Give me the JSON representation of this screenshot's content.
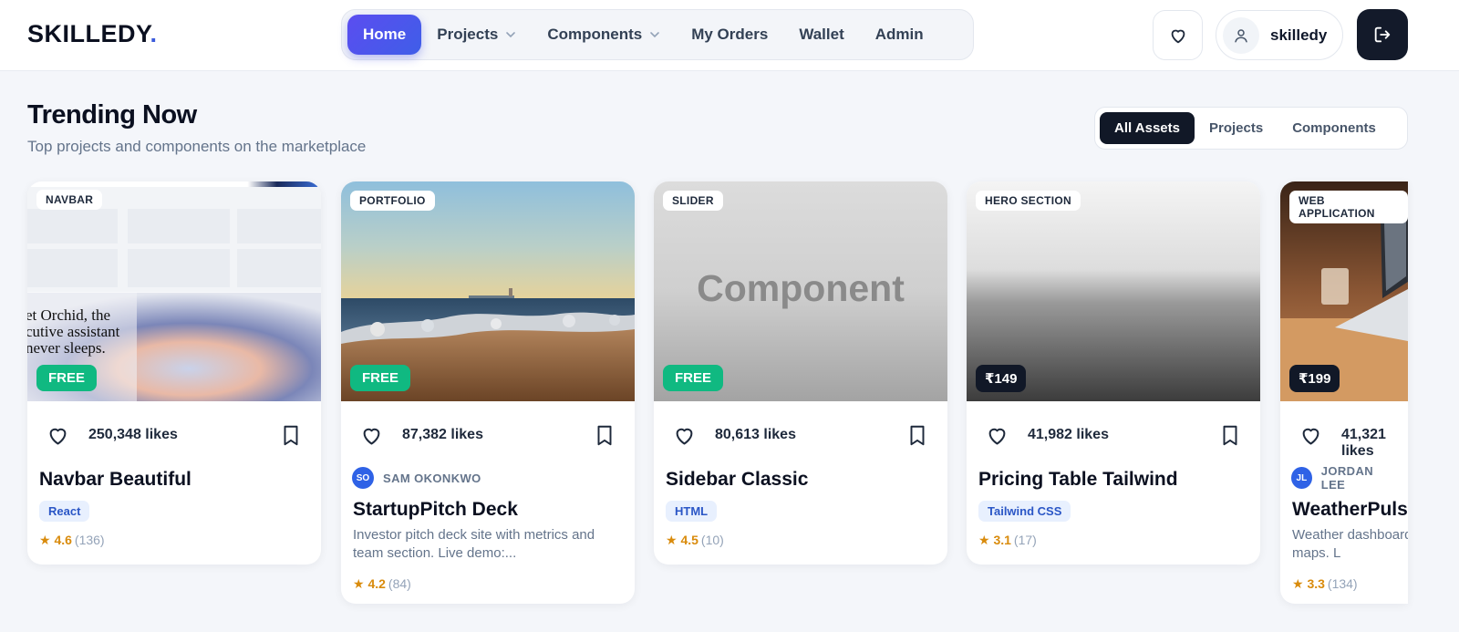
{
  "header": {
    "logo_text": "SKILLEDY",
    "logo_dot": ".",
    "nav": [
      {
        "label": "Home",
        "active": true,
        "dropdown": false
      },
      {
        "label": "Projects",
        "active": false,
        "dropdown": true
      },
      {
        "label": "Components",
        "active": false,
        "dropdown": true
      },
      {
        "label": "My Orders",
        "active": false,
        "dropdown": false
      },
      {
        "label": "Wallet",
        "active": false,
        "dropdown": false
      },
      {
        "label": "Admin",
        "active": false,
        "dropdown": false
      }
    ],
    "username": "skilledy"
  },
  "section": {
    "title": "Trending Now",
    "subtitle": "Top projects and components on the marketplace",
    "filters": [
      {
        "label": "All Assets",
        "active": true
      },
      {
        "label": "Projects",
        "active": false
      },
      {
        "label": "Components",
        "active": false
      }
    ]
  },
  "cards": [
    {
      "category": "NAVBAR",
      "badge": "FREE",
      "badge_type": "free",
      "likes": "250,348 likes",
      "title": "Navbar Beautiful",
      "tag": "React",
      "rating": "★ 4.6",
      "rating_count": "(136)",
      "image": "navbar-screenshot"
    },
    {
      "category": "PORTFOLIO",
      "badge": "FREE",
      "badge_type": "free",
      "likes": "87,382 likes",
      "author_initials": "SO",
      "author": "SAM OKONKWO",
      "title": "StartupPitch Deck",
      "description": "Investor pitch deck site with metrics and team section. Live demo:...",
      "rating": "★ 4.2",
      "rating_count": "(84)",
      "image": "coast-photo"
    },
    {
      "category": "SLIDER",
      "badge": "FREE",
      "badge_type": "free",
      "likes": "80,613 likes",
      "title": "Sidebar Classic",
      "tag": "HTML",
      "rating": "★ 4.5",
      "rating_count": "(10)",
      "image_text": "Component",
      "image": "placeholder"
    },
    {
      "category": "HERO SECTION",
      "badge": "₹149",
      "badge_type": "price",
      "likes": "41,982 likes",
      "title": "Pricing Table Tailwind",
      "tag": "Tailwind CSS",
      "rating": "★ 3.1",
      "rating_count": "(17)",
      "image": "foggy-sea-photo"
    },
    {
      "category": "WEB APPLICATION",
      "badge": "₹199",
      "badge_type": "price",
      "likes": "41,321 likes",
      "author_initials": "JL",
      "author": "JORDAN LEE",
      "title": "WeatherPulse",
      "description": "Weather dashboard with forecasts and radar maps. L",
      "rating": "★ 3.3",
      "rating_count": "(134)",
      "image": "laptop-photo"
    }
  ],
  "colors": {
    "accent": "#4f55ee",
    "free_badge": "#10b981",
    "dark": "#111827",
    "rating": "#d98b0c"
  }
}
